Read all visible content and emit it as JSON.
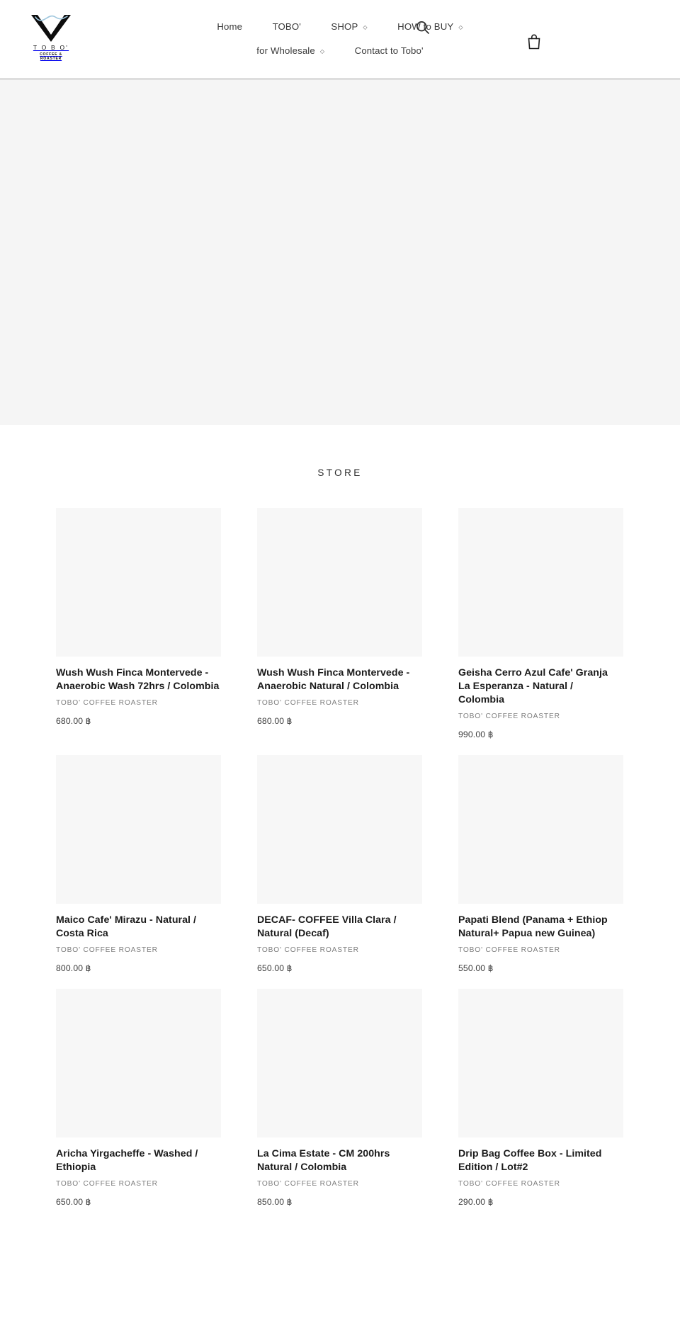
{
  "header": {
    "logo": {
      "name": "T O B O'",
      "tagline": "COFFEE & ROASTER",
      "wave_color": "#9ec6dd",
      "mark_color": "#0d0d0d"
    },
    "nav_row_1": [
      {
        "label": "Home",
        "has_dropdown": false
      },
      {
        "label": "TOBO'",
        "has_dropdown": false
      },
      {
        "label": "SHOP",
        "has_dropdown": true,
        "caret": "◇"
      },
      {
        "label": "HOW to BUY",
        "has_dropdown": true,
        "caret": "◇"
      }
    ],
    "nav_row_2": [
      {
        "label": "for Wholesale",
        "has_dropdown": true,
        "caret": "◇"
      },
      {
        "label": "Contact to Tobo'",
        "has_dropdown": false
      }
    ],
    "search_icon": "search-icon",
    "cart_icon": "shopping-bag-icon"
  },
  "hero": {
    "background_color": "#f5f5f5"
  },
  "store": {
    "title": "STORE",
    "image_placeholder_color": "#f7f7f7",
    "products": [
      {
        "title_lines": [
          "Wush Wush Finca Montervede -",
          "Anaerobic Wash 72hrs / Colombia"
        ],
        "vendor": "TOBO' COFFEE ROASTER",
        "price": "680.00 ฿"
      },
      {
        "title_lines": [
          "Wush Wush Finca Montervede -",
          "Anaerobic Natural / Colombia"
        ],
        "vendor": "TOBO' COFFEE ROASTER",
        "price": "680.00 ฿"
      },
      {
        "title_lines": [
          "Geisha Cerro Azul Cafe' Granja",
          "La Esperanza - Natural /",
          "Colombia"
        ],
        "vendor": "TOBO' COFFEE ROASTER",
        "price": "990.00 ฿"
      },
      {
        "title_lines": [
          "Maico Cafe' Mirazu - Natural /",
          "Costa Rica"
        ],
        "vendor": "TOBO' COFFEE ROASTER",
        "price": "800.00 ฿"
      },
      {
        "title_lines": [
          "DECAF- COFFEE Villa Clara /",
          "Natural (Decaf)"
        ],
        "vendor": "TOBO' COFFEE ROASTER",
        "price": "650.00 ฿"
      },
      {
        "title_lines": [
          "Papati Blend (Panama + Ethiop",
          "Natural+ Papua new Guinea)"
        ],
        "vendor": "TOBO' COFFEE ROASTER",
        "price": "550.00 ฿"
      },
      {
        "title_lines": [
          "Aricha Yirgacheffe - Washed /",
          "Ethiopia"
        ],
        "vendor": "TOBO' COFFEE ROASTER",
        "price": "650.00 ฿"
      },
      {
        "title_lines": [
          "La Cima Estate - CM 200hrs",
          "Natural / Colombia"
        ],
        "vendor": "TOBO' COFFEE ROASTER",
        "price": "850.00 ฿"
      },
      {
        "title_lines": [
          "Drip Bag Coffee Box - Limited",
          "Edition / Lot#2"
        ],
        "vendor": "TOBO' COFFEE ROASTER",
        "price": "290.00 ฿"
      }
    ]
  }
}
